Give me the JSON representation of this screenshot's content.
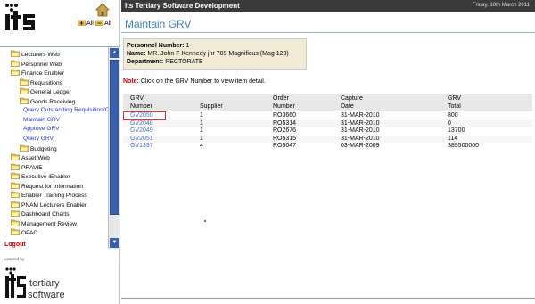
{
  "left": {
    "expand_all": "All",
    "collapse_all": "All",
    "menu": [
      {
        "label": "Lecturers Web",
        "level": 0
      },
      {
        "label": "Personnel Web",
        "level": 0
      },
      {
        "label": "Finance Enabler",
        "level": 0
      },
      {
        "label": "Requisitions",
        "level": 1
      },
      {
        "label": "General Ledger",
        "level": 1
      },
      {
        "label": "Goods Receiving",
        "level": 1
      },
      {
        "label": "Query Outstanding Requisition/Or",
        "level": 2
      },
      {
        "label": "Maintain GRV",
        "level": 2
      },
      {
        "label": "Approve GRV",
        "level": 2
      },
      {
        "label": "Query GRV",
        "level": 2
      },
      {
        "label": "Budgeting",
        "level": 1
      },
      {
        "label": "Asset Web",
        "level": 0
      },
      {
        "label": "PRAVIE",
        "level": 0
      },
      {
        "label": "Executive iEnabler",
        "level": 0
      },
      {
        "label": "Request for Information",
        "level": 0
      },
      {
        "label": "Enabler Training Process",
        "level": 0
      },
      {
        "label": "PNAM Lecturers Enabler",
        "level": 0
      },
      {
        "label": "Dashboard Charts",
        "level": 0
      },
      {
        "label": "Management Review",
        "level": 0
      },
      {
        "label": "OPAC",
        "level": 0
      }
    ],
    "logout": "Logout",
    "powered_by": "powered by",
    "brand_line1": "tertiary",
    "brand_line2": "software"
  },
  "header": {
    "app_title": "Its Tertiary Software Development",
    "date": "Friday, 18th March 2011"
  },
  "page": {
    "title": "Maintain GRV",
    "personnel_label": "Personnel Number:",
    "personnel_value": "1",
    "name_label": "Name:",
    "name_value": "MR. John F Kennedy jnr 789 Magnificus (Mag 123)",
    "department_label": "Department:",
    "department_value": "RECTORATE",
    "note_prefix": "Note:",
    "note_text": "Click on the GRV Number to view item detail."
  },
  "table": {
    "headers": [
      [
        "GRV",
        "Number"
      ],
      [
        "",
        "Supplier"
      ],
      [
        "Order",
        "Number"
      ],
      [
        "Capture",
        "Date"
      ],
      [
        "GRV",
        "Total"
      ]
    ],
    "rows": [
      [
        "GV2050",
        "1",
        "RO3660",
        "31-MAR-2010",
        "800"
      ],
      [
        "GV2048",
        "1",
        "RO5314",
        "31-MAR-2010",
        "0"
      ],
      [
        "GV2049",
        "1",
        "RO2676",
        "31-MAR-2010",
        "13700"
      ],
      [
        "GV2051",
        "1",
        "RO5315",
        "31-MAR-2010",
        "114"
      ],
      [
        "GV1397",
        "4",
        "RO5047",
        "03-MAR-2009",
        "389500000"
      ]
    ]
  },
  "colors": {
    "accent": "#3d7fbf",
    "header_bg": "#3a3a3a",
    "info_bg": "#f1ebd6",
    "link": "#4a73c8",
    "logout": "#cc0000"
  }
}
